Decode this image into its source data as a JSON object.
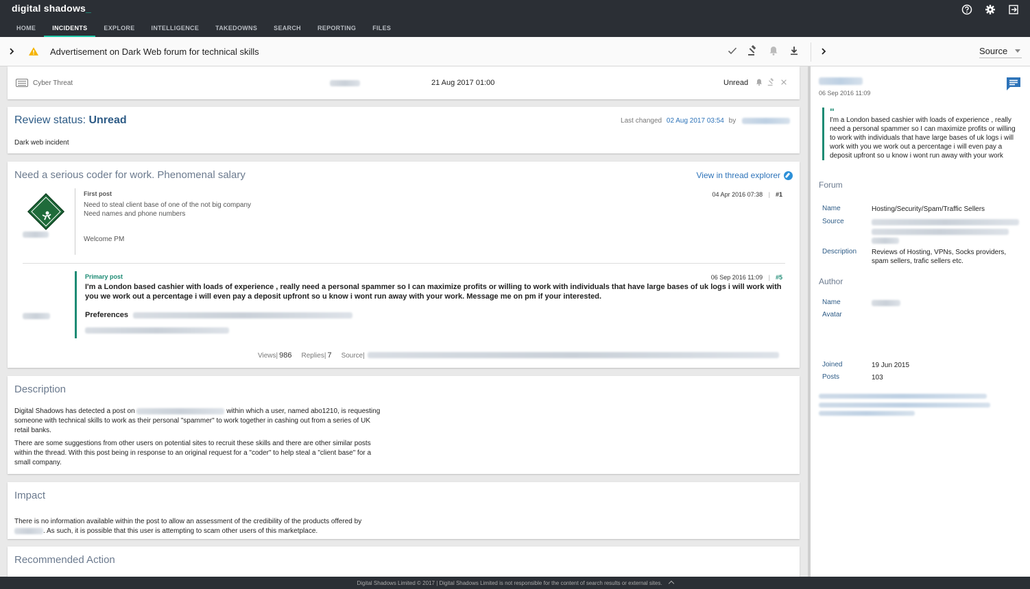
{
  "app": {
    "logo": "digital shadows",
    "logo_cursor": "_"
  },
  "nav": {
    "tabs": [
      "HOME",
      "INCIDENTS",
      "EXPLORE",
      "INTELLIGENCE",
      "TAKEDOWNS",
      "SEARCH",
      "REPORTING",
      "FILES"
    ],
    "active": "INCIDENTS"
  },
  "top_icons": [
    "help-icon",
    "gear-icon",
    "logout-icon"
  ],
  "titlebar": {
    "title": "Advertisement on Dark Web forum for technical skills",
    "actions": [
      "check-icon",
      "gavel-icon",
      "bell-icon",
      "download-icon"
    ],
    "source_select": "Source"
  },
  "incident_row": {
    "category": "Cyber Threat",
    "date": "21 Aug 2017 01:00",
    "status": "Unread"
  },
  "review": {
    "label": "Review status: ",
    "status": "Unread",
    "last_changed_label": "Last changed",
    "last_changed_date": "02 Aug 2017 03:54",
    "by_label": "by",
    "body": "Dark web incident"
  },
  "thread": {
    "title": "Need a serious coder for work. Phenomenal salary",
    "explorer_link": "View in thread explorer",
    "first_post": {
      "label": "First post",
      "date": "04 Apr 2016 07:38",
      "num": "#1",
      "line1": "Need to steal client base of one of the not big company",
      "line2": "Need names and phone numbers",
      "line3": "Welcome PM"
    },
    "primary_post": {
      "label": "Primary post",
      "date": "06 Sep 2016 11:09",
      "num": "#5",
      "text": "I'm a London based cashier with loads of experience , really need a personal spammer so I can maximize profits or willing to work with individuals that have large bases of uk logs i will work with you we work out a percentage i will even pay a deposit upfront so u know i wont run away with your work. Message me on pm if your interested.",
      "preferences_label": "Preferences"
    },
    "stats": {
      "views_label": "Views",
      "views": "986",
      "replies_label": "Replies",
      "replies": "7",
      "source_label": "Source"
    }
  },
  "description": {
    "heading": "Description",
    "p1_a": "Digital Shadows has detected a post on",
    "p1_b": "within which a user, named abo1210, is requesting someone with technical skills to work as their personal \"spammer\" to work together in cashing out from a series of UK retail banks.",
    "p2": "There are some suggestions from other users on potential sites to recruit these skills and there are other similar posts within the thread. With this post being in response to an original request for a \"coder\" to help steal a \"client base\" for a small company."
  },
  "impact": {
    "heading": "Impact",
    "p1_a": "There is no information available within the post to allow an assessment of the credibility of the products offered by",
    "p1_b": ". As such, it is possible that this user is attempting to scam other users of this marketplace."
  },
  "recommended": {
    "heading": "Recommended Action"
  },
  "panel": {
    "date": "06 Sep 2016 11:09",
    "quote": "I'm a London based cashier with loads of experience , really need a personal spammer so I can maximize profits or willing to work with individuals that have large bases of uk logs i will work with you we work out a percentage i will even pay a deposit upfront so u know i wont run away with your work",
    "forum_heading": "Forum",
    "forum_name_label": "Name",
    "forum_name": "Hosting/Security/Spam/Traffic Sellers",
    "forum_source_label": "Source",
    "forum_desc_label": "Description",
    "forum_desc": "Reviews of Hosting, VPNs, Socks providers, spam sellers, trafic sellers etc.",
    "author_heading": "Author",
    "author_name_label": "Name",
    "author_avatar_label": "Avatar",
    "joined_label": "Joined",
    "joined": "19 Jun 2015",
    "posts_label": "Posts",
    "posts": "103"
  },
  "footer": {
    "text": "Digital Shadows Limited © 2017 | Digital Shadows Limited is not responsible for the content of search results or external sites."
  },
  "colors": {
    "nav_bg": "#2b2f35",
    "accent_teal": "#1cc6a6",
    "primary_green": "#1d8b74",
    "link_blue": "#2d73b9",
    "heading_blue": "#2d5b86",
    "warning": "#f5b400"
  }
}
